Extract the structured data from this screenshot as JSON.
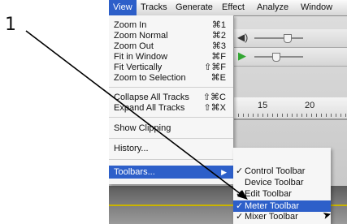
{
  "callout": {
    "number": "1"
  },
  "menubar": {
    "items": [
      "View",
      "Tracks",
      "Generate",
      "Effect",
      "Analyze",
      "Window"
    ]
  },
  "view_menu": {
    "items": [
      {
        "label": "Zoom In",
        "shortcut": "⌘1"
      },
      {
        "label": "Zoom Normal",
        "shortcut": "⌘2"
      },
      {
        "label": "Zoom Out",
        "shortcut": "⌘3"
      },
      {
        "label": "Fit in Window",
        "shortcut": "⌘F"
      },
      {
        "label": "Fit Vertically",
        "shortcut": "⇧⌘F"
      },
      {
        "label": "Zoom to Selection",
        "shortcut": "⌘E"
      },
      {
        "label": "Collapse All Tracks",
        "shortcut": "⇧⌘C"
      },
      {
        "label": "Expand All Tracks",
        "shortcut": "⇧⌘X"
      },
      {
        "label": "Show Clipping",
        "shortcut": ""
      },
      {
        "label": "History...",
        "shortcut": ""
      },
      {
        "label": "Toolbars...",
        "shortcut": ""
      }
    ]
  },
  "toolbars_submenu": {
    "items": [
      {
        "label": "Control Toolbar",
        "checked": true
      },
      {
        "label": "Device Toolbar",
        "checked": false
      },
      {
        "label": "Edit Toolbar",
        "checked": true
      },
      {
        "label": "Meter Toolbar",
        "checked": true
      },
      {
        "label": "Mixer Toolbar",
        "checked": true
      }
    ],
    "check_glyph": "✓"
  },
  "ruler": {
    "ticks": [
      "15",
      "20"
    ]
  },
  "icons": {
    "volume": "speaker-icon",
    "play": "play-icon",
    "submenu_arrow": "triangle-right-icon",
    "cursor": "mouse-pointer-icon"
  },
  "colors": {
    "highlight": "#2d5fc9",
    "play_green": "#32a632",
    "track_line": "#c9b400"
  }
}
